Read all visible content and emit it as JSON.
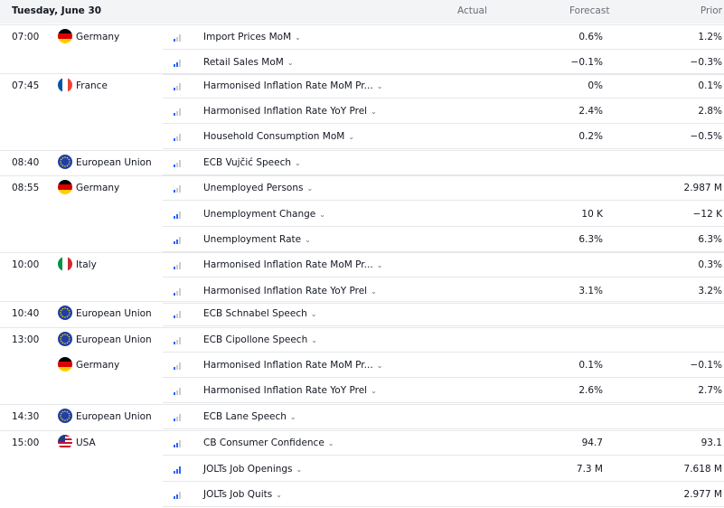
{
  "header": {
    "date": "Tuesday, June 30",
    "actual": "Actual",
    "forecast": "Forecast",
    "prior": "Prior"
  },
  "rows": [
    {
      "time": "07:00",
      "flag": "de",
      "country": "Germany",
      "importance": 1,
      "event": "Import Prices MoM",
      "actual": "",
      "forecast": "0.6%",
      "prior": "1.2%"
    },
    {
      "time": "",
      "flag": "",
      "country": "",
      "importance": 2,
      "event": "Retail Sales MoM",
      "actual": "",
      "forecast": "−0.1%",
      "prior": "−0.3%"
    },
    {
      "time": "07:45",
      "flag": "fr",
      "country": "France",
      "importance": 1,
      "event": "Harmonised Inflation Rate MoM Pr...",
      "actual": "",
      "forecast": "0%",
      "prior": "0.1%"
    },
    {
      "time": "",
      "flag": "",
      "country": "",
      "importance": 1,
      "event": "Harmonised Inflation Rate YoY Prel",
      "actual": "",
      "forecast": "2.4%",
      "prior": "2.8%"
    },
    {
      "time": "",
      "flag": "",
      "country": "",
      "importance": 1,
      "event": "Household Consumption MoM",
      "actual": "",
      "forecast": "0.2%",
      "prior": "−0.5%"
    },
    {
      "time": "08:40",
      "flag": "eu",
      "country": "European Union",
      "importance": 1,
      "event": "ECB Vujčić Speech",
      "actual": "",
      "forecast": "",
      "prior": ""
    },
    {
      "time": "08:55",
      "flag": "de",
      "country": "Germany",
      "importance": 1,
      "event": "Unemployed Persons",
      "actual": "",
      "forecast": "",
      "prior": "2.987 M"
    },
    {
      "time": "",
      "flag": "",
      "country": "",
      "importance": 2,
      "event": "Unemployment Change",
      "actual": "",
      "forecast": "10 K",
      "prior": "−12 K"
    },
    {
      "time": "",
      "flag": "",
      "country": "",
      "importance": 2,
      "event": "Unemployment Rate",
      "actual": "",
      "forecast": "6.3%",
      "prior": "6.3%"
    },
    {
      "time": "10:00",
      "flag": "it",
      "country": "Italy",
      "importance": 1,
      "event": "Harmonised Inflation Rate MoM Pr...",
      "actual": "",
      "forecast": "",
      "prior": "0.3%"
    },
    {
      "time": "",
      "flag": "",
      "country": "",
      "importance": 1,
      "event": "Harmonised Inflation Rate YoY Prel",
      "actual": "",
      "forecast": "3.1%",
      "prior": "3.2%"
    },
    {
      "time": "10:40",
      "flag": "eu",
      "country": "European Union",
      "importance": 1,
      "event": "ECB Schnabel Speech",
      "actual": "",
      "forecast": "",
      "prior": ""
    },
    {
      "time": "13:00",
      "flag": "eu",
      "country": "European Union",
      "importance": 1,
      "event": "ECB Cipollone Speech",
      "actual": "",
      "forecast": "",
      "prior": ""
    },
    {
      "time": "",
      "flag": "de",
      "country": "Germany",
      "importance": 1,
      "event": "Harmonised Inflation Rate MoM Pr...",
      "actual": "",
      "forecast": "0.1%",
      "prior": "−0.1%"
    },
    {
      "time": "",
      "flag": "",
      "country": "",
      "importance": 1,
      "event": "Harmonised Inflation Rate YoY Prel",
      "actual": "",
      "forecast": "2.6%",
      "prior": "2.7%"
    },
    {
      "time": "14:30",
      "flag": "eu",
      "country": "European Union",
      "importance": 1,
      "event": "ECB Lane Speech",
      "actual": "",
      "forecast": "",
      "prior": ""
    },
    {
      "time": "15:00",
      "flag": "us",
      "country": "USA",
      "importance": 2,
      "event": "CB Consumer Confidence",
      "actual": "",
      "forecast": "94.7",
      "prior": "93.1"
    },
    {
      "time": "",
      "flag": "",
      "country": "",
      "importance": 3,
      "event": "JOLTs Job Openings",
      "actual": "",
      "forecast": "7.3 M",
      "prior": "7.618 M"
    },
    {
      "time": "",
      "flag": "",
      "country": "",
      "importance": 2,
      "event": "JOLTs Job Quits",
      "actual": "",
      "forecast": "",
      "prior": "2.977 M"
    }
  ]
}
